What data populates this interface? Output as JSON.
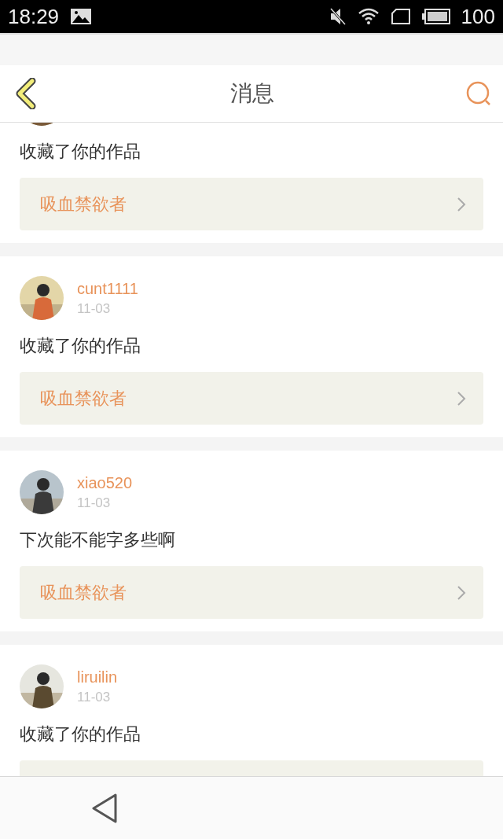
{
  "status_bar": {
    "time": "18:29",
    "battery": "100"
  },
  "header": {
    "title": "消息"
  },
  "messages": [
    {
      "text": "收藏了你的作品",
      "work": "吸血禁欲者"
    },
    {
      "user": "cunt1111",
      "date": "11-03",
      "text": "收藏了你的作品",
      "work": "吸血禁欲者"
    },
    {
      "user": "xiao520",
      "date": "11-03",
      "text": "下次能不能字多些啊",
      "work": "吸血禁欲者"
    },
    {
      "user": "liruilin",
      "date": "11-03",
      "text": "收藏了你的作品"
    }
  ]
}
